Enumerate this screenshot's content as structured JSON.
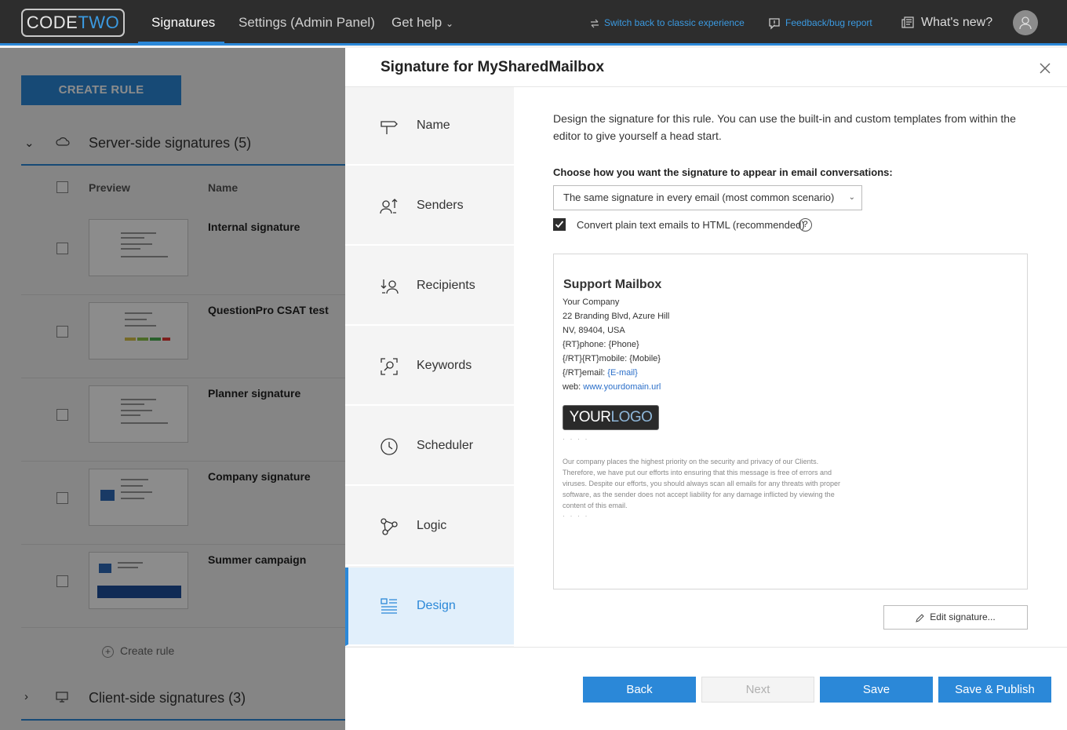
{
  "nav": {
    "logo_code": "CODE",
    "logo_two": "TWO",
    "items": [
      "Signatures",
      "Settings (Admin Panel)",
      "Get help"
    ],
    "get_help_caret": "⌄",
    "switch_classic": "Switch back to classic experience",
    "feedback": "Feedback/bug report",
    "whats_new": "What's new?"
  },
  "background": {
    "create_rule": "CREATE RULE",
    "server_group": "Server-side signatures (5)",
    "client_group": "Client-side signatures (3)",
    "col_preview": "Preview",
    "col_name": "Name",
    "rules": [
      "Internal signature",
      "QuestionPro CSAT test",
      "Planner signature",
      "Company signature",
      "Summer campaign"
    ],
    "create_rule_link": "Create rule"
  },
  "modal": {
    "title": "Signature for MySharedMailbox",
    "steps": [
      "Name",
      "Senders",
      "Recipients",
      "Keywords",
      "Scheduler",
      "Logic",
      "Design"
    ],
    "active_step": "Design",
    "intro": "Design the signature for this rule. You can use the built-in and custom templates from within the editor to give yourself a head start.",
    "choose_label": "Choose how you want the signature to appear in email conversations:",
    "select_value": "The same signature in every email (most common scenario)",
    "convert_label": "Convert plain text emails to HTML (recommended)",
    "convert_checked": true,
    "help": "?",
    "signature": {
      "name": "Support Mailbox",
      "company": "Your Company",
      "address1": "22 Branding Blvd, Azure Hill",
      "address2": "NV, 89404, USA",
      "phone": "{RT}phone: {Phone}",
      "mobile": "{/RT}{RT}mobile: {Mobile}",
      "email_prefix": "{/RT}email: ",
      "email_value": "{E-mail}",
      "web_prefix": "web: ",
      "web_value": "www.yourdomain.url",
      "logo_your": "YOUR",
      "logo_logo": "LOGO",
      "dots": "· · · ·",
      "disclaimer": "Our company places the highest priority on the security and privacy of our Clients. Therefore, we have put our efforts into ensuring that this message is free of errors and viruses. Despite our efforts, you should always scan all emails for any threats with proper software, as the sender does not accept liability for any damage inflicted by viewing the content of this email."
    },
    "edit_signature": "Edit signature...",
    "buttons": {
      "back": "Back",
      "next": "Next",
      "save": "Save",
      "save_publish": "Save & Publish"
    }
  },
  "colors": {
    "accent": "#2b88d8",
    "topbar": "#2d2d2d"
  }
}
